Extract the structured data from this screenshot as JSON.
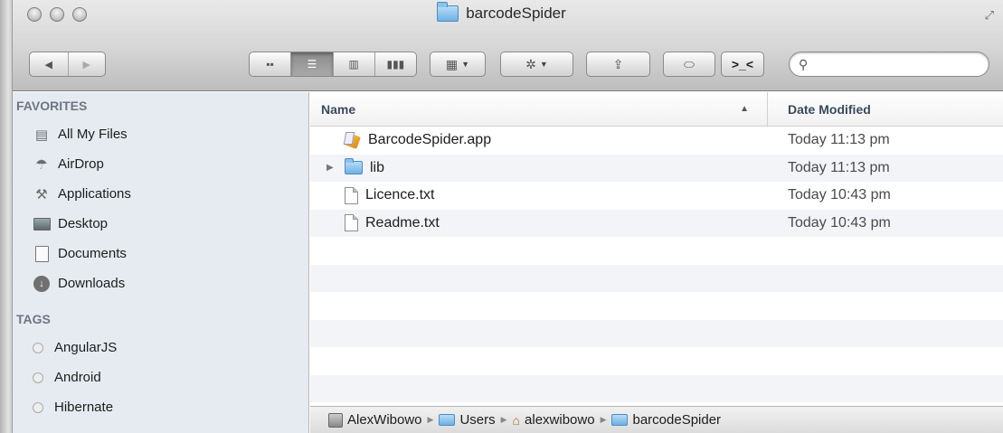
{
  "window": {
    "title": "barcodeSpider"
  },
  "toolbar": {
    "back_icon": "back-arrow-icon",
    "forward_icon": "forward-arrow-icon",
    "view_modes": [
      "icon-view-icon",
      "list-view-icon",
      "column-view-icon",
      "coverflow-view-icon"
    ],
    "active_view": "list",
    "arrange_icon": "arrange-grid-icon",
    "action_icon": "gear-icon",
    "share_icon": "share-icon",
    "tag_icon": "tag-icon",
    "terminal_label": ">_<",
    "search": {
      "value": "",
      "placeholder": ""
    }
  },
  "sidebar": {
    "favorites_heading": "FAVORITES",
    "favorites": [
      {
        "label": "All My Files",
        "icon": "all-files-icon"
      },
      {
        "label": "AirDrop",
        "icon": "airdrop-icon"
      },
      {
        "label": "Applications",
        "icon": "applications-icon"
      },
      {
        "label": "Desktop",
        "icon": "desktop-icon"
      },
      {
        "label": "Documents",
        "icon": "documents-icon"
      },
      {
        "label": "Downloads",
        "icon": "downloads-icon"
      }
    ],
    "tags_heading": "TAGS",
    "tags": [
      {
        "label": "AngularJS"
      },
      {
        "label": "Android"
      },
      {
        "label": "Hibernate"
      }
    ]
  },
  "filelist": {
    "columns": {
      "name": "Name",
      "date": "Date Modified"
    },
    "rows": [
      {
        "name": "BarcodeSpider.app",
        "date": "Today 11:13 pm",
        "type": "app"
      },
      {
        "name": "lib",
        "date": "Today 11:13 pm",
        "type": "folder"
      },
      {
        "name": "Licence.txt",
        "date": "Today 10:43 pm",
        "type": "text"
      },
      {
        "name": "Readme.txt",
        "date": "Today 10:43 pm",
        "type": "text"
      }
    ]
  },
  "pathbar": {
    "items": [
      "AlexWibowo",
      "Users",
      "alexwibowo",
      "barcodeSpider"
    ]
  },
  "colors": {
    "sidebar_bg": "#e6ebf1",
    "heading_color": "#6d7784",
    "folder_blue": "#6fb0e4",
    "stripe": "#f2f4f7"
  }
}
